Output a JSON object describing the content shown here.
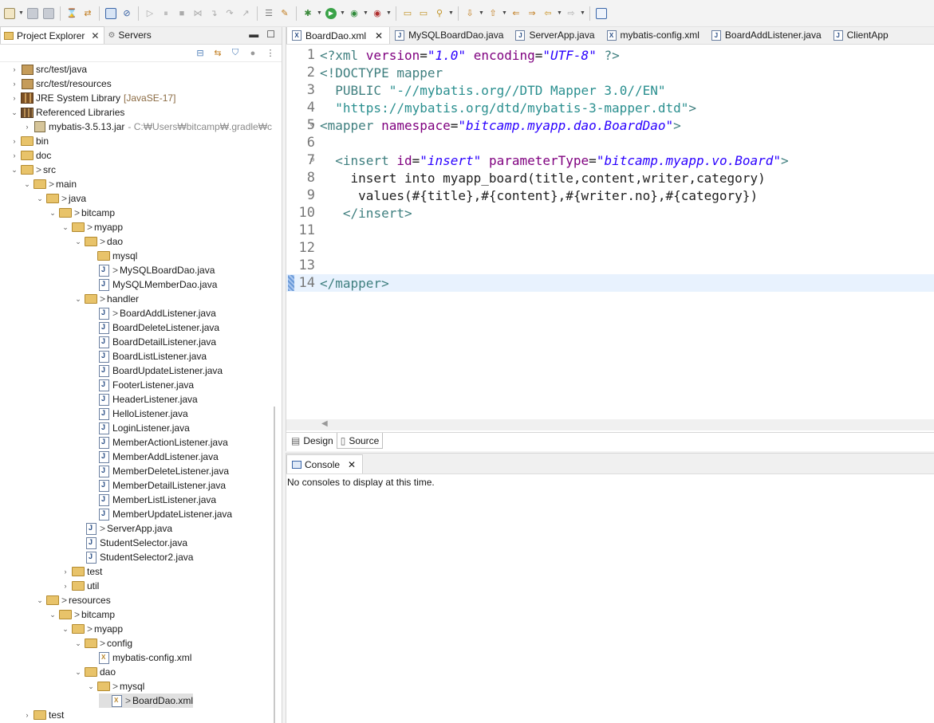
{
  "left_panel": {
    "tab_explorer": "Project Explorer",
    "tab_servers": "Servers",
    "tree": [
      {
        "indent": 0,
        "twisty": "›",
        "icon": "pkg",
        "label": "src/test/java"
      },
      {
        "indent": 0,
        "twisty": "›",
        "icon": "pkg",
        "label": "src/test/resources"
      },
      {
        "indent": 0,
        "twisty": "›",
        "icon": "jre",
        "label": "JRE System Library",
        "extra": "[JavaSE-17]"
      },
      {
        "indent": 0,
        "twisty": "⌄",
        "icon": "reflib",
        "label": "Referenced Libraries"
      },
      {
        "indent": 1,
        "twisty": "›",
        "icon": "jar",
        "label": "mybatis-3.5.13.jar",
        "extra": "- C:₩Users₩bitcamp₩.gradle₩c"
      },
      {
        "indent": 0,
        "twisty": "›",
        "icon": "folder",
        "label": "bin"
      },
      {
        "indent": 0,
        "twisty": "›",
        "icon": "folder",
        "label": "doc"
      },
      {
        "indent": 0,
        "twisty": "⌄",
        "icon": "folder",
        "dec": "> ",
        "label": "src"
      },
      {
        "indent": 1,
        "twisty": "⌄",
        "icon": "folder",
        "dec": "> ",
        "label": "main"
      },
      {
        "indent": 2,
        "twisty": "⌄",
        "icon": "folder",
        "dec": "> ",
        "label": "java"
      },
      {
        "indent": 3,
        "twisty": "⌄",
        "icon": "folder",
        "dec": "> ",
        "label": "bitcamp"
      },
      {
        "indent": 4,
        "twisty": "⌄",
        "icon": "folder",
        "dec": "> ",
        "label": "myapp"
      },
      {
        "indent": 5,
        "twisty": "⌄",
        "icon": "folder",
        "dec": "> ",
        "label": "dao"
      },
      {
        "indent": 6,
        "twisty": "",
        "icon": "folder",
        "label": "mysql"
      },
      {
        "indent": 6,
        "twisty": "",
        "icon": "java",
        "dec": "> ",
        "label": "MySQLBoardDao.java"
      },
      {
        "indent": 6,
        "twisty": "",
        "icon": "java",
        "label": "MySQLMemberDao.java"
      },
      {
        "indent": 5,
        "twisty": "⌄",
        "icon": "folder",
        "dec": "> ",
        "label": "handler"
      },
      {
        "indent": 6,
        "twisty": "",
        "icon": "java",
        "dec": "> ",
        "label": "BoardAddListener.java"
      },
      {
        "indent": 6,
        "twisty": "",
        "icon": "java",
        "label": "BoardDeleteListener.java"
      },
      {
        "indent": 6,
        "twisty": "",
        "icon": "java",
        "label": "BoardDetailListener.java"
      },
      {
        "indent": 6,
        "twisty": "",
        "icon": "java",
        "label": "BoardListListener.java"
      },
      {
        "indent": 6,
        "twisty": "",
        "icon": "java",
        "label": "BoardUpdateListener.java"
      },
      {
        "indent": 6,
        "twisty": "",
        "icon": "java",
        "label": "FooterListener.java"
      },
      {
        "indent": 6,
        "twisty": "",
        "icon": "java",
        "label": "HeaderListener.java"
      },
      {
        "indent": 6,
        "twisty": "",
        "icon": "java",
        "label": "HelloListener.java"
      },
      {
        "indent": 6,
        "twisty": "",
        "icon": "java",
        "label": "LoginListener.java"
      },
      {
        "indent": 6,
        "twisty": "",
        "icon": "java",
        "label": "MemberActionListener.java"
      },
      {
        "indent": 6,
        "twisty": "",
        "icon": "java",
        "label": "MemberAddListener.java"
      },
      {
        "indent": 6,
        "twisty": "",
        "icon": "java",
        "label": "MemberDeleteListener.java"
      },
      {
        "indent": 6,
        "twisty": "",
        "icon": "java",
        "label": "MemberDetailListener.java"
      },
      {
        "indent": 6,
        "twisty": "",
        "icon": "java",
        "label": "MemberListListener.java"
      },
      {
        "indent": 6,
        "twisty": "",
        "icon": "java",
        "label": "MemberUpdateListener.java"
      },
      {
        "indent": 5,
        "twisty": "",
        "icon": "java",
        "dec": "> ",
        "label": "ServerApp.java"
      },
      {
        "indent": 5,
        "twisty": "",
        "icon": "java",
        "label": "StudentSelector.java"
      },
      {
        "indent": 5,
        "twisty": "",
        "icon": "java",
        "label": "StudentSelector2.java"
      },
      {
        "indent": 4,
        "twisty": "›",
        "icon": "folder",
        "label": "test"
      },
      {
        "indent": 4,
        "twisty": "›",
        "icon": "folder",
        "label": "util"
      },
      {
        "indent": 2,
        "twisty": "⌄",
        "icon": "folder",
        "dec": "> ",
        "label": "resources"
      },
      {
        "indent": 3,
        "twisty": "⌄",
        "icon": "folder",
        "dec": "> ",
        "label": "bitcamp"
      },
      {
        "indent": 4,
        "twisty": "⌄",
        "icon": "folder",
        "dec": "> ",
        "label": "myapp"
      },
      {
        "indent": 5,
        "twisty": "⌄",
        "icon": "folder",
        "dec": "> ",
        "label": "config"
      },
      {
        "indent": 6,
        "twisty": "",
        "icon": "xml",
        "label": "mybatis-config.xml"
      },
      {
        "indent": 5,
        "twisty": "⌄",
        "icon": "folder",
        "label": "dao"
      },
      {
        "indent": 6,
        "twisty": "⌄",
        "icon": "folder",
        "dec": "> ",
        "label": "mysql"
      },
      {
        "indent": 7,
        "twisty": "",
        "icon": "xml",
        "dec": "> ",
        "label": "BoardDao.xml",
        "selected": true
      },
      {
        "indent": 1,
        "twisty": "›",
        "icon": "folder",
        "label": "test"
      }
    ]
  },
  "editor": {
    "tabs": [
      {
        "label": "BoardDao.xml",
        "icon": "X",
        "active": true
      },
      {
        "label": "MySQLBoardDao.java",
        "icon": "J"
      },
      {
        "label": "ServerApp.java",
        "icon": "J"
      },
      {
        "label": "mybatis-config.xml",
        "icon": "X"
      },
      {
        "label": "BoardAddListener.java",
        "icon": "J"
      },
      {
        "label": "ClientApp",
        "icon": "J"
      }
    ],
    "lines": [
      {
        "n": "1",
        "parts": [
          [
            "k",
            "<?xml "
          ],
          [
            "a",
            "version"
          ],
          [
            "ct",
            "="
          ],
          [
            "v",
            "\"1.0\""
          ],
          [
            "ct",
            " "
          ],
          [
            "a",
            "encoding"
          ],
          [
            "ct",
            "="
          ],
          [
            "v",
            "\"UTF-8\""
          ],
          [
            "k",
            " ?>"
          ]
        ]
      },
      {
        "n": "2",
        "parts": [
          [
            "d",
            "<!DOCTYPE mapper"
          ]
        ]
      },
      {
        "n": "3",
        "parts": [
          [
            "d",
            "  PUBLIC "
          ],
          [
            "s",
            "\"-//mybatis.org//DTD Mapper 3.0//EN\""
          ]
        ]
      },
      {
        "n": "4",
        "parts": [
          [
            "s",
            "  \"https://mybatis.org/dtd/mybatis-3-mapper.dtd\""
          ],
          [
            "d",
            ">"
          ]
        ]
      },
      {
        "n": "5",
        "fold": true,
        "parts": [
          [
            "k",
            "<mapper "
          ],
          [
            "a",
            "namespace"
          ],
          [
            "ct",
            "="
          ],
          [
            "v",
            "\"bitcamp.myapp.dao.BoardDao\""
          ],
          [
            "k",
            ">"
          ]
        ]
      },
      {
        "n": "6",
        "parts": []
      },
      {
        "n": "7",
        "fold": true,
        "parts": [
          [
            "ct",
            "  "
          ],
          [
            "k",
            "<insert "
          ],
          [
            "a",
            "id"
          ],
          [
            "ct",
            "="
          ],
          [
            "v",
            "\"insert\""
          ],
          [
            "ct",
            " "
          ],
          [
            "a",
            "parameterType"
          ],
          [
            "ct",
            "="
          ],
          [
            "v",
            "\"bitcamp.myapp.vo.Board\""
          ],
          [
            "k",
            ">"
          ]
        ]
      },
      {
        "n": "8",
        "parts": [
          [
            "ct",
            "    insert into myapp_board(title,content,writer,category)"
          ]
        ]
      },
      {
        "n": "9",
        "parts": [
          [
            "ct",
            "     values(#{title},#{content},#{writer.no},#{category})"
          ]
        ]
      },
      {
        "n": "10",
        "parts": [
          [
            "ct",
            "   "
          ],
          [
            "k",
            "</insert>"
          ]
        ]
      },
      {
        "n": "11",
        "parts": []
      },
      {
        "n": "12",
        "parts": []
      },
      {
        "n": "13",
        "parts": []
      },
      {
        "n": "14",
        "current": true,
        "parts": [
          [
            "k",
            "</mapper>"
          ]
        ]
      }
    ],
    "design_tab": "Design",
    "source_tab": "Source"
  },
  "console": {
    "tab_label": "Console",
    "message": "No consoles to display at this time."
  }
}
